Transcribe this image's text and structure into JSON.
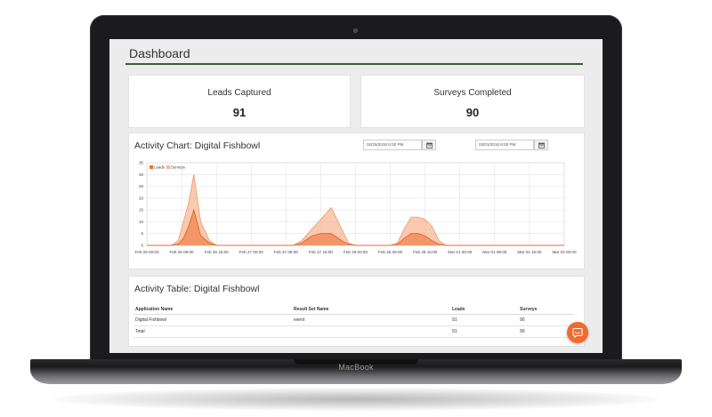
{
  "device": {
    "brand": "MacBook"
  },
  "dashboard": {
    "title": "Dashboard"
  },
  "stats": [
    {
      "label": "Leads Captured",
      "value": "91"
    },
    {
      "label": "Surveys Completed",
      "value": "90"
    }
  ],
  "activity_chart": {
    "title": "Activity Chart: Digital Fishbowl",
    "start_date": "02/25/2018 6:00 PM",
    "end_date": "03/01/2018 6:00 PM",
    "calendar_icon": "calendar-icon"
  },
  "chart_data": {
    "type": "area",
    "title": "",
    "xlabel": "",
    "ylabel": "",
    "ylim": [
      0,
      35
    ],
    "y_ticks": [
      0,
      5,
      10,
      15,
      20,
      25,
      30,
      35
    ],
    "x_tick_labels": [
      "Feb 26 00:00",
      "Feb 26 08:00",
      "Feb 26 16:00",
      "Feb 27 00:00",
      "Feb 27 08:00",
      "Feb 27 16:00",
      "Feb 28 00:00",
      "Feb 28 08:00",
      "Feb 28 15:00",
      "Mar 01 00:00",
      "Mar 01 08:00",
      "Mar 01 16:00",
      "Mar 02 00:00"
    ],
    "grid": true,
    "legend_position": "top-left",
    "x": [
      0,
      0.4,
      0.7,
      0.9,
      1.05,
      1.2,
      1.35,
      1.55,
      1.8,
      2.0,
      2.2,
      4.0,
      4.2,
      4.45,
      4.75,
      5.0,
      5.3,
      5.6,
      5.8,
      6.0,
      7.0,
      7.2,
      7.4,
      7.6,
      7.8,
      8.0,
      8.2,
      8.4,
      8.6,
      12
    ],
    "series": [
      {
        "name": "Leads",
        "color": "#f26b2e",
        "values": [
          0,
          0,
          0,
          0.6,
          3,
          8,
          15,
          4,
          1,
          0,
          0,
          0,
          0,
          1,
          4,
          5,
          5,
          2,
          0.5,
          0,
          0,
          0.5,
          3,
          5,
          5,
          4,
          2,
          0.5,
          0,
          0
        ]
      },
      {
        "name": "Surveys",
        "color": "#f7b48e",
        "values": [
          0,
          0,
          0,
          2,
          10,
          18,
          30,
          10,
          2,
          0,
          0,
          0,
          0,
          2,
          7,
          11,
          16,
          7,
          1,
          0,
          0,
          1,
          7,
          12,
          12,
          11,
          8,
          2,
          0,
          0
        ]
      }
    ]
  },
  "activity_table": {
    "title": "Activity Table: Digital Fishbowl",
    "headers": [
      "Application Name",
      "Result Set Name",
      "Leads",
      "Surveys"
    ],
    "rows": [
      [
        "Digital Fishbowl",
        "event",
        "91",
        "90"
      ],
      [
        "Total",
        "",
        "91",
        "90"
      ]
    ]
  },
  "chat": {
    "icon": "chat-icon"
  }
}
